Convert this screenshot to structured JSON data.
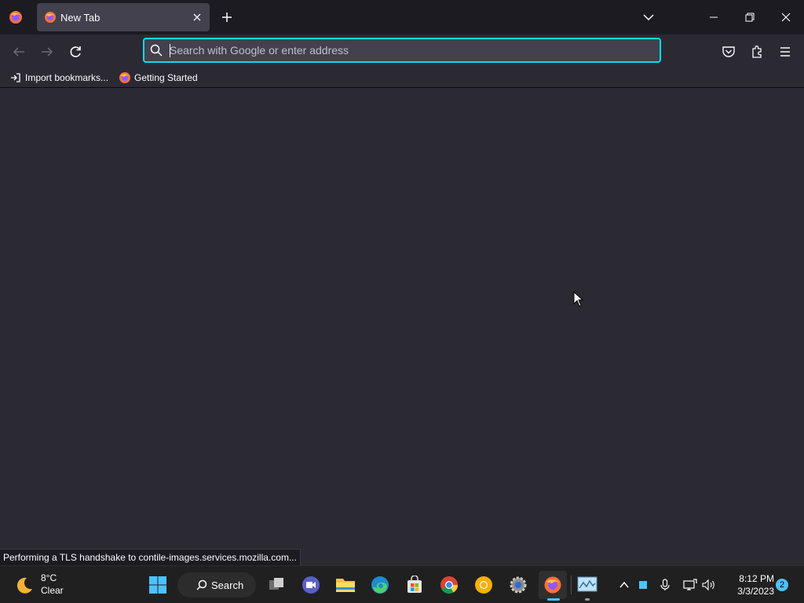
{
  "browser": {
    "tab": {
      "title": "New Tab"
    },
    "urlbar": {
      "placeholder": "Search with Google or enter address",
      "value": ""
    },
    "bookmarks": [
      {
        "label": "Import bookmarks..."
      },
      {
        "label": "Getting Started"
      }
    ],
    "status_text": "Performing a TLS handshake to contile-images.services.mozilla.com...",
    "accent_color": "#00ddff"
  },
  "taskbar": {
    "weather": {
      "temp": "8°C",
      "condition": "Clear"
    },
    "search_label": "Search",
    "pinned_apps": [
      "start-icon",
      "search",
      "task-view-icon",
      "meet-icon",
      "file-explorer-icon",
      "edge-icon",
      "store-icon",
      "chrome-icon",
      "chrome-canary-icon",
      "settings-icon",
      "firefox-icon",
      "system-monitor-icon"
    ],
    "clock": {
      "time": "8:12 PM",
      "date": "3/3/2023"
    },
    "notification_count": "2"
  }
}
